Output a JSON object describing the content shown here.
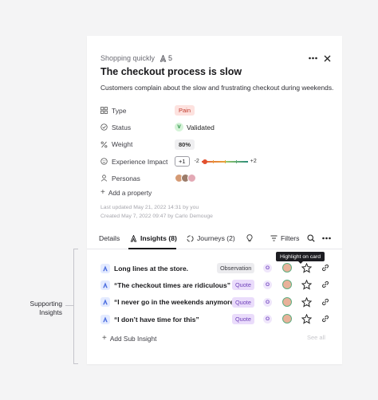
{
  "card": {
    "breadcrumb": "Shopping quickly",
    "insight_count": "5",
    "title": "The checkout process is slow",
    "description": "Customers complain about the slow and frustrating checkout during weekends."
  },
  "properties": {
    "type_label": "Type",
    "type_value": "Pain",
    "status_label": "Status",
    "status_badge": "V",
    "status_value": "Validated",
    "weight_label": "Weight",
    "weight_value": "80%",
    "impact_label": "Experience Impact",
    "impact_value": "+1",
    "impact_min": "-2",
    "impact_max": "+2",
    "personas_label": "Personas",
    "add_property": "Add a property"
  },
  "meta": {
    "updated": "Last updated May 21, 2022 14:31 by you",
    "created": "Created May 7, 2022 09:47 by Carlo Demouge"
  },
  "tabs": [
    {
      "label": "Details"
    },
    {
      "label": "Insights (8)"
    },
    {
      "label": "Journeys (2)"
    },
    {
      "label": "Filters"
    }
  ],
  "tooltip": "Highlight on card",
  "insights": [
    {
      "text": "Long lines at the store.",
      "type": "Observation",
      "badge": "O"
    },
    {
      "text": "“The checkout times are ridiculous”",
      "type": "Quote",
      "badge": "O"
    },
    {
      "text": "“I never go in the weekends anymore”",
      "type": "Quote",
      "badge": "O"
    },
    {
      "text": "“I don’t have time for this”",
      "type": "Quote",
      "badge": "O"
    }
  ],
  "add_sub_insight": "Add Sub Insight",
  "see_all": "See all",
  "annotation": "Supporting Insights",
  "colors": {
    "pain_bg": "#fde2df",
    "pain_text": "#c0392b",
    "validated": "#1f8a3b",
    "quote_bg": "#eadcfb",
    "insight_icon": "#4d6fe0"
  }
}
